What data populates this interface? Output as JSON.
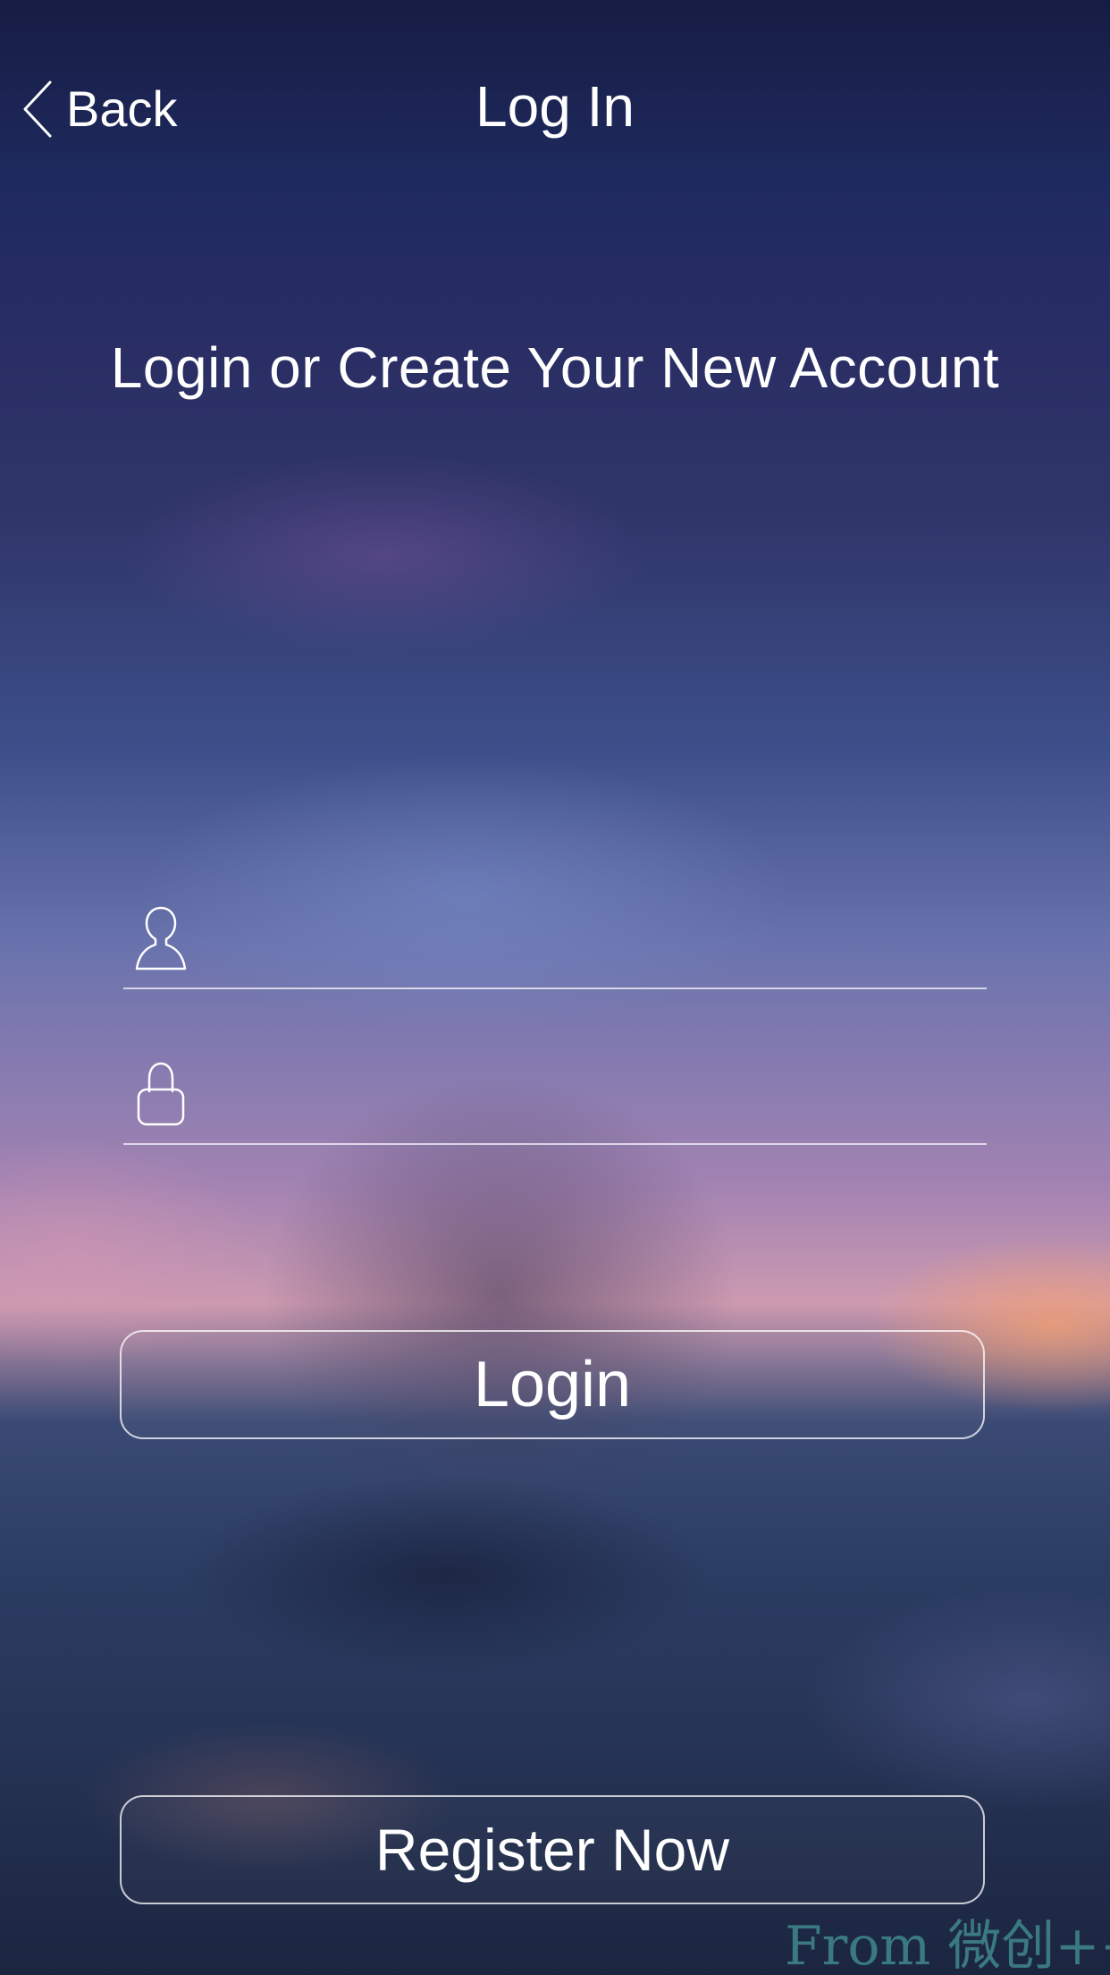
{
  "nav": {
    "back_label": "Back",
    "title": "Log In",
    "back_icon": "chevron-left-icon"
  },
  "headline": "Login or Create Your New Account",
  "form": {
    "username": {
      "icon": "user-icon",
      "value": "",
      "placeholder": ""
    },
    "password": {
      "icon": "lock-icon",
      "value": "",
      "placeholder": ""
    }
  },
  "buttons": {
    "login_label": "Login",
    "register_label": "Register Now"
  },
  "watermark": "From 微创++",
  "colors": {
    "text": "#ffffff",
    "field_underline": "#ffffff",
    "button_border": "#ffffff",
    "watermark": "#4a9696"
  }
}
